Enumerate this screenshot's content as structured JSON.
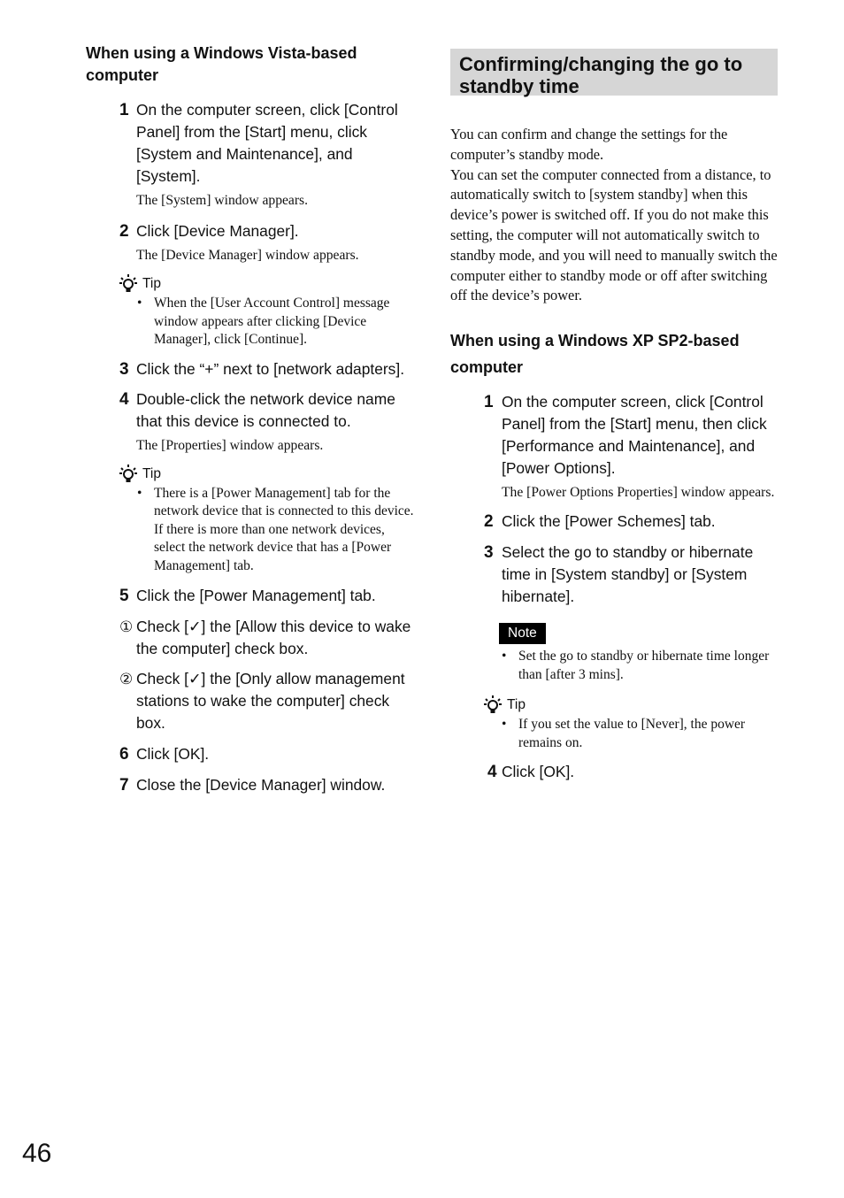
{
  "page_number": "46",
  "left_column": {
    "heading": "When using a Windows Vista-based computer",
    "steps": [
      {
        "num": "1",
        "text": "On the computer screen, click [Control Panel] from the [Start] menu, click [System and Maintenance], and [System].",
        "result": "The [System] window appears."
      },
      {
        "num": "2",
        "text": "Click [Device Manager].",
        "result": "The [Device Manager] window appears."
      }
    ],
    "tip1": {
      "label": "Tip",
      "icon": "lightbulb-icon",
      "bullets": [
        "When the [User Account Control] message window appears after clicking [Device Manager], click [Continue]."
      ]
    },
    "steps2": [
      {
        "num": "3",
        "text": "Click the “+” next to [network adapters]."
      },
      {
        "num": "4",
        "text": "Double-click the network device name that this device is connected to.",
        "result": "The [Properties] window appears."
      }
    ],
    "tip2": {
      "label": "Tip",
      "icon": "lightbulb-icon",
      "bullets": [
        "There is a [Power Management] tab for the network device that is connected to this device. If there is more than one network devices, select the network device that has a [Power Management] tab."
      ]
    },
    "step5": {
      "num": "5",
      "text": "Click the [Power Management] tab."
    },
    "substeps": [
      {
        "mark": "①",
        "text": "Check [✓] the [Allow this device to wake the computer] check box."
      },
      {
        "mark": "②",
        "text": "Check [✓] the [Only allow management stations to wake the computer] check box."
      }
    ],
    "steps3": [
      {
        "num": "6",
        "text": "Click [OK]."
      },
      {
        "num": "7",
        "text": "Close the [Device Manager] window."
      }
    ]
  },
  "right_column": {
    "section_title": "Confirming/changing the go to standby time",
    "intro": [
      "You can confirm and change the settings for the computer’s standby mode.",
      "You can set the computer connected from a distance, to automatically switch to [system standby] when this device’s power is switched off. If you do not make this setting, the computer will not automatically switch to standby mode, and you will need to manually switch the computer either to standby mode or off after switching off the device’s power."
    ],
    "heading": "When using a Windows XP SP2-based computer",
    "steps": [
      {
        "num": "1",
        "text": "On the computer screen, click [Control Panel] from the [Start] menu, then click [Performance and Maintenance], and [Power Options].",
        "result": "The [Power Options Properties] window appears."
      },
      {
        "num": "2",
        "text": "Click the [Power Schemes] tab."
      },
      {
        "num": "3",
        "text": "Select the go to standby or hibernate time in [System standby] or [System hibernate]."
      }
    ],
    "note": {
      "label": "Note",
      "bullets": [
        "Set the go to standby or hibernate time longer than [after 3 mins]."
      ]
    },
    "tip": {
      "label": "Tip",
      "icon": "lightbulb-icon",
      "bullets": [
        "If you set the value to [Never], the power remains on."
      ]
    },
    "step4": {
      "num": "4",
      "text": "Click [OK]."
    }
  }
}
